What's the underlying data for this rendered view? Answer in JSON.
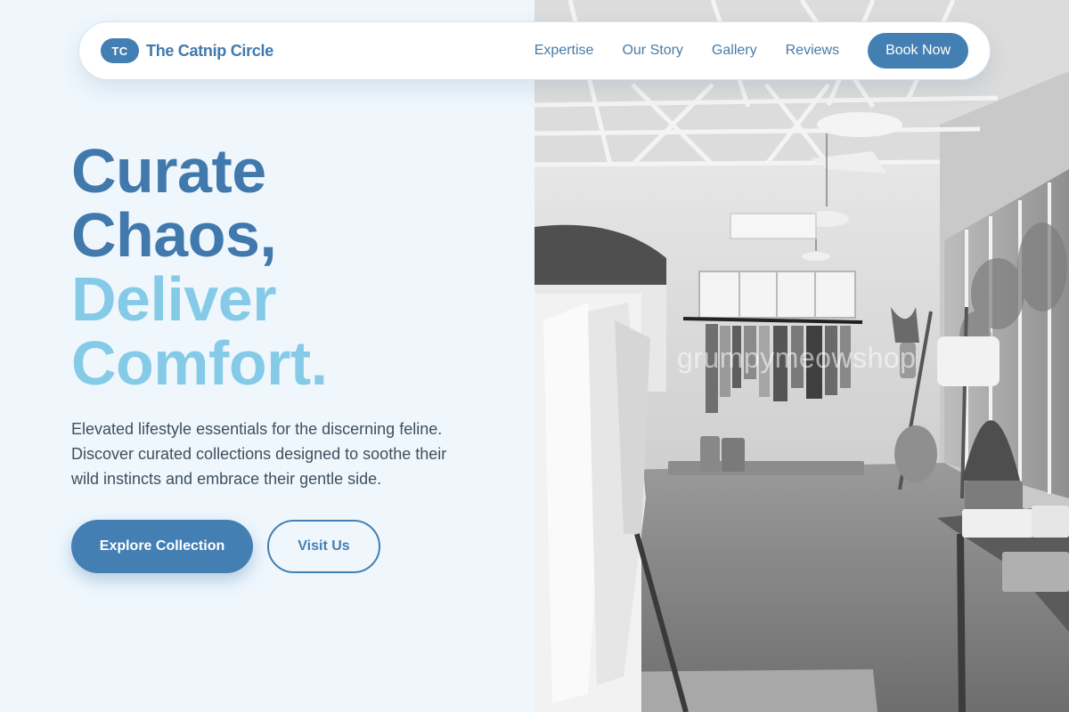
{
  "brand": {
    "badge": "TC",
    "name": "The Catnip Circle"
  },
  "nav": {
    "links": [
      "Expertise",
      "Our Story",
      "Gallery",
      "Reviews"
    ],
    "cta": "Book Now"
  },
  "hero": {
    "title_line1": "Curate",
    "title_line2": "Chaos,",
    "title_line3": "Deliver",
    "title_line4": "Comfort.",
    "description": "Elevated lifestyle essentials for the discerning feline. Discover curated collections designed to soothe their wild instincts and embrace their gentle side.",
    "primary_button": "Explore Collection",
    "secondary_button": "Visit Us"
  },
  "photo": {
    "watermark": "grumpymeowshop"
  },
  "colors": {
    "accent": "#447fb3",
    "accent_light": "#85cbe8",
    "background": "#eff7fd",
    "body_text": "#3f4f5d"
  },
  "icons": {
    "photo": "boutique-interior-photo"
  }
}
